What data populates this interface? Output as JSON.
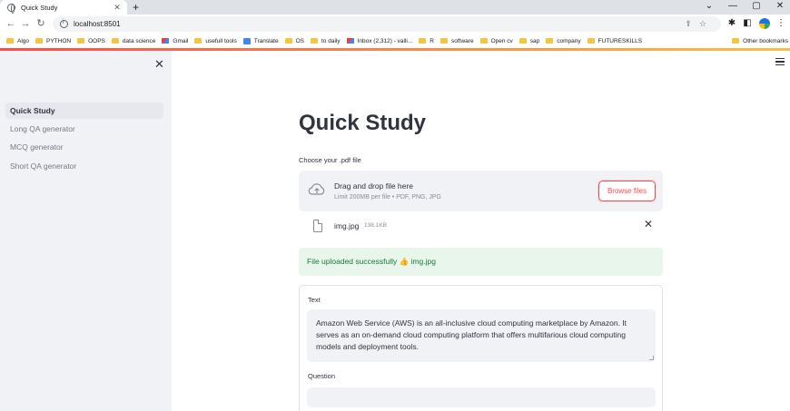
{
  "browser": {
    "tab_title": "Quick Study",
    "tab_close": "✕",
    "new_tab": "+",
    "url": "localhost:8501",
    "win_min": "—",
    "win_max": "▢",
    "win_close": "✕",
    "win_chevron": "⌄",
    "bookmarks": [
      {
        "label": "Algo",
        "icon": "folder-icon"
      },
      {
        "label": "PYTHON",
        "icon": "folder-icon"
      },
      {
        "label": "OOPS",
        "icon": "folder-icon"
      },
      {
        "label": "data science",
        "icon": "folder-icon"
      },
      {
        "label": "Gmail",
        "icon": "gmail-icon"
      },
      {
        "label": "usefull tools",
        "icon": "folder-icon"
      },
      {
        "label": "Translate",
        "icon": "translate-icon"
      },
      {
        "label": "OS",
        "icon": "folder-icon"
      },
      {
        "label": "to daily",
        "icon": "folder-icon"
      },
      {
        "label": "Inbox (2,312) - valli...",
        "icon": "gmail-icon"
      },
      {
        "label": "R",
        "icon": "folder-icon"
      },
      {
        "label": "software",
        "icon": "folder-icon"
      },
      {
        "label": "Open cv",
        "icon": "folder-icon"
      },
      {
        "label": "sap",
        "icon": "folder-icon"
      },
      {
        "label": "company",
        "icon": "folder-icon"
      },
      {
        "label": "FUTURESKILLS",
        "icon": "folder-icon"
      }
    ],
    "other_bookmarks": "Other bookmarks"
  },
  "sidebar": {
    "close": "✕",
    "items": [
      {
        "label": "Quick Study",
        "active": true
      },
      {
        "label": "Long QA generator",
        "active": false
      },
      {
        "label": "MCQ generator",
        "active": false
      },
      {
        "label": "Short QA generator",
        "active": false
      }
    ]
  },
  "main": {
    "title": "Quick Study",
    "uploader": {
      "label": "Choose your .pdf file",
      "drop_title": "Drag and drop file here",
      "drop_limit": "Limit 200MB per file • PDF, PNG, JPG",
      "browse_label": "Browse files"
    },
    "file": {
      "name": "img.jpg",
      "size": "138.1KB",
      "remove": "✕"
    },
    "success_message": "File uploaded successfully 👍 img.jpg",
    "form": {
      "text_label": "Text",
      "text_value": "Amazon Web Service (AWS) is an all-inclusive cloud computing marketplace by Amazon. It serves as an on-demand cloud computing platform that offers multifarious cloud computing models and deployment tools.",
      "question_label": "Question",
      "question_value": ""
    }
  },
  "colors": {
    "accent": "#ff4b4b",
    "sidebar_bg": "#f0f2f6",
    "success_bg": "#e8f6ec",
    "success_text": "#1b7a3a"
  }
}
